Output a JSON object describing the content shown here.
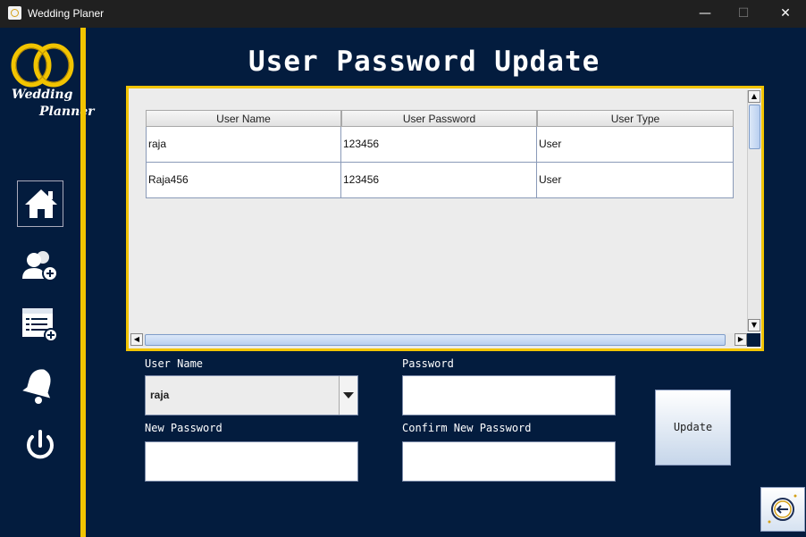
{
  "window": {
    "title": "Wedding Planer",
    "minimize": "—",
    "maximize": "☐",
    "close": "✕"
  },
  "logo": {
    "line1": "Wedding",
    "line2": "Planner"
  },
  "sidebar": {
    "items": [
      {
        "icon": "home-icon"
      },
      {
        "icon": "add-user-icon"
      },
      {
        "icon": "add-list-icon"
      },
      {
        "icon": "bell-icon"
      },
      {
        "icon": "power-icon"
      }
    ]
  },
  "page": {
    "title": "User Password Update"
  },
  "table": {
    "columns": [
      "User Name",
      "User Password",
      "User Type"
    ],
    "rows": [
      [
        "raja",
        "123456",
        "User"
      ],
      [
        "Raja456",
        "123456",
        "User"
      ]
    ]
  },
  "form": {
    "user_name_label": "User Name",
    "user_name_value": "raja",
    "password_label": "Password",
    "password_value": "",
    "new_password_label": "New Password",
    "new_password_value": "",
    "confirm_password_label": "Confirm New Password",
    "confirm_password_value": "",
    "update_label": "Update"
  },
  "colors": {
    "background": "#031c3e",
    "accent": "#f2c400"
  }
}
